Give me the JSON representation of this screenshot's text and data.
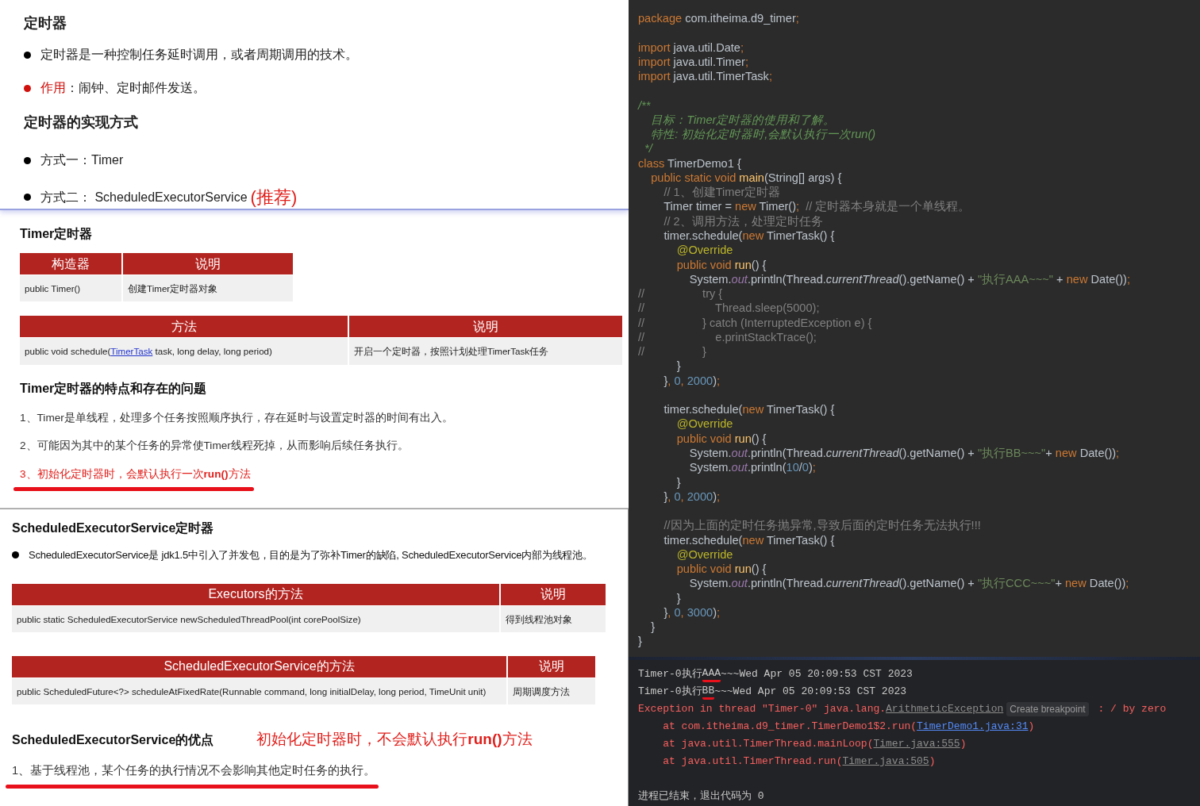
{
  "notes": [
    {
      "blocks": [
        {
          "kind": "heading",
          "text": "定时器"
        },
        {
          "kind": "bullet",
          "text": "定时器是一种控制任务延时调用，或者周期调用的技术。",
          "emphasis": false
        },
        {
          "kind": "bullet",
          "label": "作用",
          "text": "：闹钟、定时邮件发送。",
          "emphasis": true
        },
        {
          "kind": "heading",
          "text": "定时器的实现方式"
        },
        {
          "kind": "bullet",
          "text": "方式一：Timer",
          "emphasis": false
        },
        {
          "kind": "bullet",
          "text": "方式二： ScheduledExecutorService",
          "tag": "(推荐)",
          "emphasis": false
        }
      ]
    },
    {
      "blocks": [
        {
          "kind": "heading",
          "text": "Timer定时器"
        },
        {
          "kind": "table",
          "columns": [
            "构造器",
            "说明"
          ],
          "rows": [
            [
              "public Timer()",
              "创建Timer定时器对象"
            ]
          ]
        },
        {
          "kind": "table",
          "columns": [
            "方法",
            "说明"
          ],
          "rows": [
            [
              {
                "parts": [
                  {
                    "kind": "plain",
                    "text": "public void schedule("
                  },
                  {
                    "kind": "link",
                    "text": "TimerTask"
                  },
                  {
                    "kind": "plain",
                    "text": " task, long delay, long period)"
                  }
                ]
              },
              "开启一个定时器，按照计划处理TimerTask任务"
            ]
          ]
        },
        {
          "kind": "heading",
          "text": "Timer定时器的特点和存在的问题"
        },
        {
          "kind": "item",
          "text": "1、Timer是单线程，处理多个任务按照顺序执行，存在延时与设置定时器的时间有出入。",
          "emphasis": false,
          "underline": false
        },
        {
          "kind": "item",
          "text": "2、可能因为其中的某个任务的异常使Timer线程死掉，从而影响后续任务执行。",
          "emphasis": false,
          "underline": false
        },
        {
          "kind": "item",
          "text": "3、初始化定时器时，会默认执行一次**run()**方法",
          "emphasis": true,
          "underline": true
        }
      ]
    },
    {
      "blocks": [
        {
          "kind": "heading",
          "text": "ScheduledExecutorService定时器"
        },
        {
          "kind": "bullet",
          "text": "ScheduledExecutorService是 jdk1.5中引入了并发包，目的是为了弥补Timer的缺陷, ScheduledExecutorService内部为线程池。",
          "emphasis": false
        },
        {
          "kind": "table",
          "columns": [
            "Executors的方法",
            "说明"
          ],
          "rows": [
            [
              "public static ScheduledExecutorService newScheduledThreadPool(int corePoolSize)",
              "得到线程池对象"
            ]
          ]
        },
        {
          "kind": "table",
          "columns": [
            "ScheduledExecutorService的方法",
            "说明"
          ],
          "rows": [
            [
              "public ScheduledFuture<?> scheduleAtFixedRate(Runnable command, long initialDelay, long period, TimeUnit unit)",
              "周期调度方法"
            ]
          ]
        },
        {
          "kind": "heading",
          "text": "ScheduledExecutorService的优点",
          "note": "初始化定时器时，不会默认执行**run()**方法"
        },
        {
          "kind": "item",
          "text": "1、基于线程池，某个任务的执行情况不会影响其他定时任务的执行。",
          "emphasis": false,
          "underline": true
        }
      ]
    }
  ],
  "code": [
    {
      "tokens": [
        {
          "kind": "keyword",
          "text": "package"
        },
        {
          "kind": "plain",
          "text": " com.itheima.d9_timer"
        },
        {
          "kind": "keyword",
          "text": ";"
        }
      ]
    },
    {
      "after_blank": true,
      "tokens": [
        {
          "kind": "keyword",
          "text": "import"
        },
        {
          "kind": "plain",
          "text": " java.util.Date"
        },
        {
          "kind": "keyword",
          "text": ";"
        }
      ]
    },
    {
      "tokens": [
        {
          "kind": "keyword",
          "text": "import"
        },
        {
          "kind": "plain",
          "text": " java.util.Timer"
        },
        {
          "kind": "keyword",
          "text": ";"
        }
      ]
    },
    {
      "tokens": [
        {
          "kind": "keyword",
          "text": "import"
        },
        {
          "kind": "plain",
          "text": " java.util.TimerTask"
        },
        {
          "kind": "keyword",
          "text": ";"
        }
      ]
    },
    {
      "after_blank": true,
      "tokens": [
        {
          "kind": "doc",
          "text": "/**"
        }
      ]
    },
    {
      "tokens": [
        {
          "kind": "doc",
          "text": "    目标：Timer定时器的使用和了解。"
        }
      ]
    },
    {
      "tokens": [
        {
          "kind": "doc",
          "text": "    特性: 初始化定时器时,会默认执行一次run()"
        }
      ]
    },
    {
      "tokens": [
        {
          "kind": "doc",
          "text": "  */"
        }
      ]
    },
    {
      "tokens": [
        {
          "kind": "keyword",
          "text": "class"
        },
        {
          "kind": "plain",
          "text": " TimerDemo1 {"
        }
      ]
    },
    {
      "tokens": [
        {
          "kind": "keyword",
          "text": "    public static void "
        },
        {
          "kind": "method",
          "text": "main"
        },
        {
          "kind": "plain",
          "text": "(String[] args) {"
        }
      ]
    },
    {
      "tokens": [
        {
          "kind": "comment",
          "text": "        // 1、创建Timer定时器"
        }
      ]
    },
    {
      "tokens": [
        {
          "kind": "plain",
          "text": "        Timer timer = "
        },
        {
          "kind": "keyword",
          "text": "new"
        },
        {
          "kind": "plain",
          "text": " Timer()"
        },
        {
          "kind": "keyword",
          "text": ";"
        },
        {
          "kind": "comment",
          "text": "  // 定时器本身就是一个单线程。"
        }
      ]
    },
    {
      "tokens": [
        {
          "kind": "comment",
          "text": "        // 2、调用方法，处理定时任务"
        }
      ]
    },
    {
      "tokens": [
        {
          "kind": "plain",
          "text": "        timer.schedule("
        },
        {
          "kind": "keyword",
          "text": "new"
        },
        {
          "kind": "plain",
          "text": " TimerTask() {"
        }
      ]
    },
    {
      "tokens": [
        {
          "kind": "annotation",
          "text": "            @Override"
        }
      ]
    },
    {
      "tokens": [
        {
          "kind": "keyword",
          "text": "            public void "
        },
        {
          "kind": "method",
          "text": "run"
        },
        {
          "kind": "plain",
          "text": "() {"
        }
      ]
    },
    {
      "tokens": [
        {
          "kind": "plain",
          "text": "                System."
        },
        {
          "kind": "field",
          "text": "out"
        },
        {
          "kind": "plain",
          "text": ".println(Thread."
        },
        {
          "kind": "italic",
          "text": "currentThread"
        },
        {
          "kind": "plain",
          "text": "().getName() + "
        },
        {
          "kind": "string",
          "text": "\"执行AAA~~~\""
        },
        {
          "kind": "plain",
          "text": " + "
        },
        {
          "kind": "keyword",
          "text": "new"
        },
        {
          "kind": "plain",
          "text": " Date())"
        },
        {
          "kind": "keyword",
          "text": ";"
        }
      ]
    },
    {
      "tokens": [
        {
          "kind": "comment",
          "text": "//                  try {"
        }
      ]
    },
    {
      "tokens": [
        {
          "kind": "comment",
          "text": "//                      Thread.sleep(5000);"
        }
      ]
    },
    {
      "tokens": [
        {
          "kind": "comment",
          "text": "//                  } catch (InterruptedException e) {"
        }
      ]
    },
    {
      "tokens": [
        {
          "kind": "comment",
          "text": "//                      e.printStackTrace();"
        }
      ]
    },
    {
      "tokens": [
        {
          "kind": "comment",
          "text": "//                  }"
        }
      ]
    },
    {
      "tokens": [
        {
          "kind": "plain",
          "text": "            }"
        }
      ]
    },
    {
      "tokens": [
        {
          "kind": "plain",
          "text": "        }"
        },
        {
          "kind": "keyword",
          "text": ", "
        },
        {
          "kind": "number",
          "text": "0"
        },
        {
          "kind": "keyword",
          "text": ", "
        },
        {
          "kind": "number",
          "text": "2000"
        },
        {
          "kind": "plain",
          "text": ")"
        },
        {
          "kind": "keyword",
          "text": ";"
        }
      ]
    },
    {
      "after_blank": true,
      "tokens": [
        {
          "kind": "plain",
          "text": "        timer.schedule("
        },
        {
          "kind": "keyword",
          "text": "new"
        },
        {
          "kind": "plain",
          "text": " TimerTask() {"
        }
      ]
    },
    {
      "tokens": [
        {
          "kind": "annotation",
          "text": "            @Override"
        }
      ]
    },
    {
      "tokens": [
        {
          "kind": "keyword",
          "text": "            public void "
        },
        {
          "kind": "method",
          "text": "run"
        },
        {
          "kind": "plain",
          "text": "() {"
        }
      ]
    },
    {
      "tokens": [
        {
          "kind": "plain",
          "text": "                System."
        },
        {
          "kind": "field",
          "text": "out"
        },
        {
          "kind": "plain",
          "text": ".println(Thread."
        },
        {
          "kind": "italic",
          "text": "currentThread"
        },
        {
          "kind": "plain",
          "text": "().getName() + "
        },
        {
          "kind": "string",
          "text": "\"执行BB~~~\""
        },
        {
          "kind": "plain",
          "text": "+ "
        },
        {
          "kind": "keyword",
          "text": "new"
        },
        {
          "kind": "plain",
          "text": " Date())"
        },
        {
          "kind": "keyword",
          "text": ";"
        }
      ]
    },
    {
      "tokens": [
        {
          "kind": "plain",
          "text": "                System."
        },
        {
          "kind": "field",
          "text": "out"
        },
        {
          "kind": "plain",
          "text": ".println("
        },
        {
          "kind": "number",
          "text": "10"
        },
        {
          "kind": "plain",
          "text": "/"
        },
        {
          "kind": "number",
          "text": "0"
        },
        {
          "kind": "plain",
          "text": ")"
        },
        {
          "kind": "keyword",
          "text": ";"
        }
      ]
    },
    {
      "tokens": [
        {
          "kind": "plain",
          "text": "            }"
        }
      ]
    },
    {
      "tokens": [
        {
          "kind": "plain",
          "text": "        }"
        },
        {
          "kind": "keyword",
          "text": ", "
        },
        {
          "kind": "number",
          "text": "0"
        },
        {
          "kind": "keyword",
          "text": ", "
        },
        {
          "kind": "number",
          "text": "2000"
        },
        {
          "kind": "plain",
          "text": ")"
        },
        {
          "kind": "keyword",
          "text": ";"
        }
      ]
    },
    {
      "after_blank": true,
      "tokens": [
        {
          "kind": "comment",
          "text": "        //因为上面的定时任务抛异常,导致后面的定时任务无法执行!!!"
        }
      ]
    },
    {
      "tokens": [
        {
          "kind": "plain",
          "text": "        timer.schedule("
        },
        {
          "kind": "keyword",
          "text": "new"
        },
        {
          "kind": "plain",
          "text": " TimerTask() {"
        }
      ]
    },
    {
      "tokens": [
        {
          "kind": "annotation",
          "text": "            @Override"
        }
      ]
    },
    {
      "tokens": [
        {
          "kind": "keyword",
          "text": "            public void "
        },
        {
          "kind": "method",
          "text": "run"
        },
        {
          "kind": "plain",
          "text": "() {"
        }
      ]
    },
    {
      "tokens": [
        {
          "kind": "plain",
          "text": "                System."
        },
        {
          "kind": "field",
          "text": "out"
        },
        {
          "kind": "plain",
          "text": ".println(Thread."
        },
        {
          "kind": "italic",
          "text": "currentThread"
        },
        {
          "kind": "plain",
          "text": "().getName() + "
        },
        {
          "kind": "string",
          "text": "\"执行CCC~~~\""
        },
        {
          "kind": "plain",
          "text": "+ "
        },
        {
          "kind": "keyword",
          "text": "new"
        },
        {
          "kind": "plain",
          "text": " Date())"
        },
        {
          "kind": "keyword",
          "text": ";"
        }
      ]
    },
    {
      "tokens": [
        {
          "kind": "plain",
          "text": "            }"
        }
      ]
    },
    {
      "tokens": [
        {
          "kind": "plain",
          "text": "        }"
        },
        {
          "kind": "keyword",
          "text": ", "
        },
        {
          "kind": "number",
          "text": "0"
        },
        {
          "kind": "keyword",
          "text": ", "
        },
        {
          "kind": "number",
          "text": "3000"
        },
        {
          "kind": "plain",
          "text": ")"
        },
        {
          "kind": "keyword",
          "text": ";"
        }
      ]
    },
    {
      "tokens": [
        {
          "kind": "plain",
          "text": "    }"
        }
      ]
    },
    {
      "tokens": [
        {
          "kind": "plain",
          "text": "}"
        }
      ]
    }
  ],
  "console": [
    {
      "segments": [
        {
          "kind": "plain",
          "text": "Timer-0执行"
        },
        {
          "kind": "marked",
          "text": "AAA"
        },
        {
          "kind": "plain",
          "text": "~~~Wed Apr 05 20:09:53 CST 2023"
        }
      ]
    },
    {
      "segments": [
        {
          "kind": "plain",
          "text": "Timer-0执行"
        },
        {
          "kind": "marked",
          "text": "BB"
        },
        {
          "kind": "plain",
          "text": "~~~Wed Apr 05 20:09:53 CST 2023"
        }
      ]
    },
    {
      "segments": [
        {
          "kind": "error",
          "text": "Exception in thread \"Timer-0\" java.lang."
        },
        {
          "kind": "muted_link",
          "text": "ArithmeticException"
        },
        {
          "kind": "hint",
          "text": "Create breakpoint"
        },
        {
          "kind": "error",
          "text": " : / by zero"
        }
      ]
    },
    {
      "segments": [
        {
          "kind": "error",
          "text": "    at com.itheima.d9_timer.TimerDemo1$2.run("
        },
        {
          "kind": "link",
          "text": "TimerDemo1.java:31"
        },
        {
          "kind": "error",
          "text": ")"
        }
      ]
    },
    {
      "segments": [
        {
          "kind": "error",
          "text": "    at java.util.TimerThread.mainLoop("
        },
        {
          "kind": "muted_link",
          "text": "Timer.java:555"
        },
        {
          "kind": "error",
          "text": ")"
        }
      ]
    },
    {
      "segments": [
        {
          "kind": "error",
          "text": "    at java.util.TimerThread.run("
        },
        {
          "kind": "muted_link",
          "text": "Timer.java:505"
        },
        {
          "kind": "error",
          "text": ")"
        }
      ]
    },
    {
      "after_blank": true,
      "segments": [
        {
          "kind": "plain",
          "text": "进程已结束，退出代码为 0"
        }
      ]
    }
  ]
}
